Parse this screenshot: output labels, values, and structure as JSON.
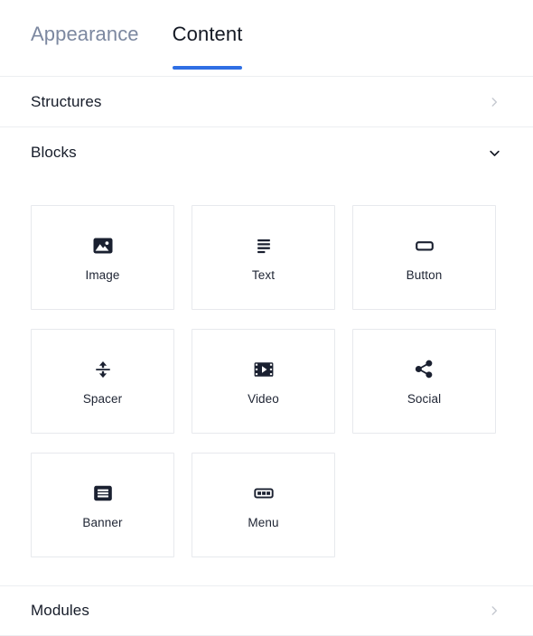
{
  "tabs": [
    {
      "label": "Appearance",
      "active": false,
      "name": "tab-appearance"
    },
    {
      "label": "Content",
      "active": true,
      "name": "tab-content"
    }
  ],
  "accent_color": "#2f6fe4",
  "sections": [
    {
      "label": "Structures",
      "state": "collapsed",
      "icon": "chevron-right-icon"
    },
    {
      "label": "Blocks",
      "state": "expanded",
      "icon": "chevron-down-icon"
    },
    {
      "label": "Modules",
      "state": "collapsed",
      "icon": "chevron-right-icon"
    }
  ],
  "blocks": [
    {
      "label": "Image",
      "icon": "image-icon"
    },
    {
      "label": "Text",
      "icon": "text-lines-icon"
    },
    {
      "label": "Button",
      "icon": "button-icon"
    },
    {
      "label": "Spacer",
      "icon": "spacer-arrows-icon"
    },
    {
      "label": "Video",
      "icon": "video-filmstrip-icon"
    },
    {
      "label": "Social",
      "icon": "share-nodes-icon"
    },
    {
      "label": "Banner",
      "icon": "banner-icon"
    },
    {
      "label": "Menu",
      "icon": "menu-blocks-icon"
    }
  ]
}
